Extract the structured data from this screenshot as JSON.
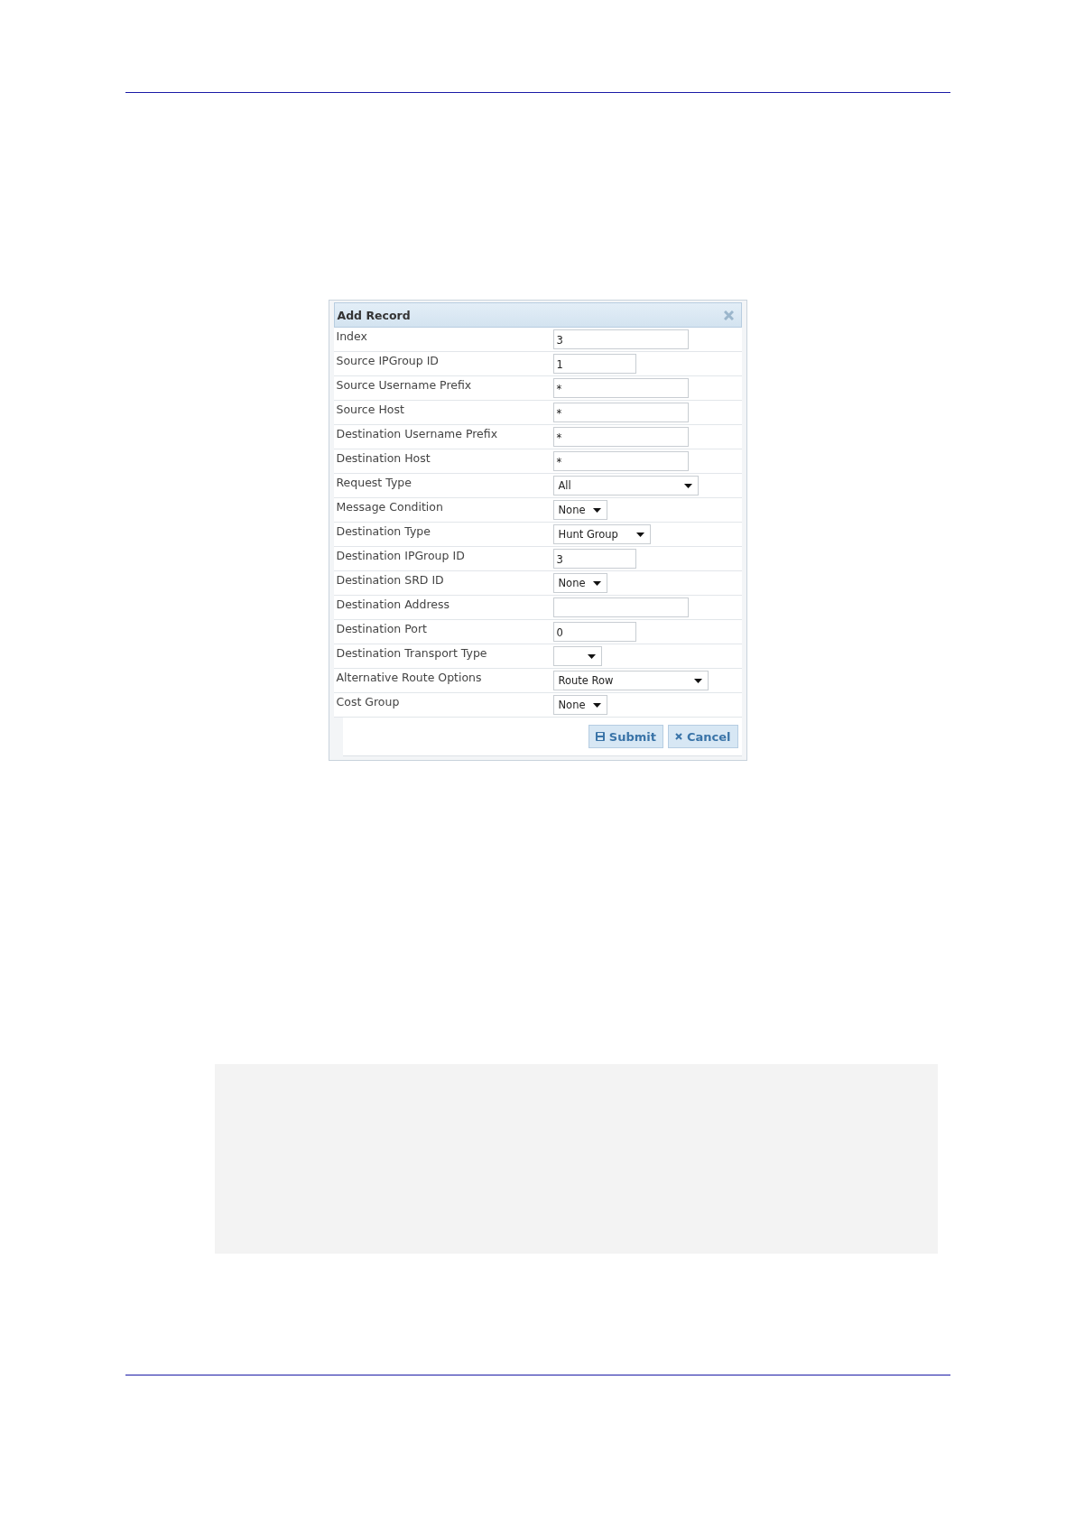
{
  "dialog": {
    "title": "Add Record",
    "fields": [
      {
        "label": "Index",
        "kind": "text",
        "value": "3"
      },
      {
        "label": "Source IPGroup ID",
        "kind": "text",
        "value": "1"
      },
      {
        "label": "Source Username Prefix",
        "kind": "text",
        "value": "*"
      },
      {
        "label": "Source Host",
        "kind": "text",
        "value": "*"
      },
      {
        "label": "Destination Username Prefix",
        "kind": "text",
        "value": "*"
      },
      {
        "label": "Destination Host",
        "kind": "text",
        "value": "*"
      },
      {
        "label": "Request Type",
        "kind": "select",
        "value": "All"
      },
      {
        "label": "Message Condition",
        "kind": "select",
        "value": "None"
      },
      {
        "label": "Destination Type",
        "kind": "select",
        "value": "Hunt Group"
      },
      {
        "label": "Destination IPGroup ID",
        "kind": "text",
        "value": "3"
      },
      {
        "label": "Destination SRD ID",
        "kind": "select",
        "value": "None"
      },
      {
        "label": "Destination Address",
        "kind": "text"
      },
      {
        "label": "Destination Port",
        "kind": "text",
        "value": "0"
      },
      {
        "label": "Destination Transport Type",
        "kind": "select"
      },
      {
        "label": "Alternative Route Options",
        "kind": "select",
        "value": "Route Row"
      },
      {
        "label": "Cost Group",
        "kind": "select",
        "value": "None"
      }
    ],
    "buttons": [
      {
        "label": "Submit",
        "kind": "submit"
      },
      {
        "label": "Cancel",
        "kind": "cancel"
      }
    ]
  }
}
